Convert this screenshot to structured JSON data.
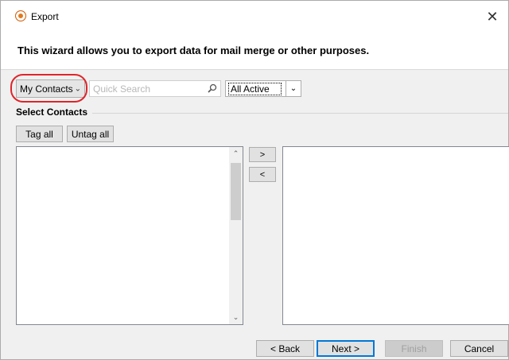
{
  "window": {
    "title": "Export",
    "close_glyph": "✕"
  },
  "wizard": {
    "description": "This wizard allows you to export data for mail merge or other purposes."
  },
  "filters": {
    "contacts_dropdown": "My Contacts",
    "search_placeholder": "Quick Search",
    "search_value": "",
    "status_dropdown": "All Active"
  },
  "select_contacts": {
    "group_label": "Select Contacts",
    "tag_all": "Tag all",
    "untag_all": "Untag all",
    "move_right": ">",
    "move_left": "<"
  },
  "footer": {
    "back": "< Back",
    "next": "Next >",
    "finish": "Finish",
    "cancel": "Cancel"
  },
  "colors": {
    "highlight": "#e0242a",
    "focus_border": "#0078d7",
    "app_icon": "#e07a1f"
  },
  "icons": [
    "app-icon",
    "close-icon",
    "search-icon",
    "chevron-down-icon",
    "scroll-up-icon",
    "scroll-down-icon"
  ]
}
